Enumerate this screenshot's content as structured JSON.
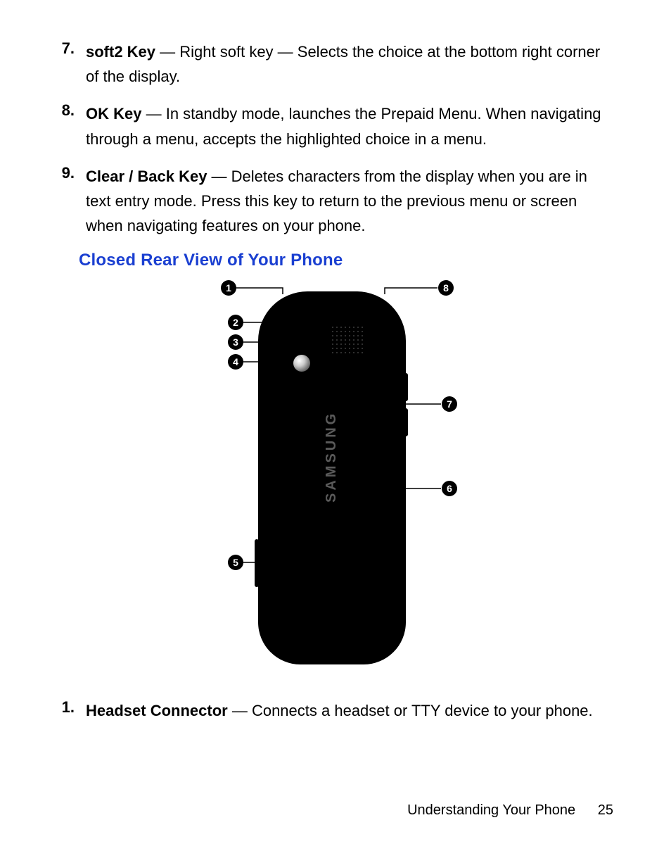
{
  "topList": [
    {
      "num": "7.",
      "term": "soft2 Key",
      "desc": " — Right soft key — Selects the choice at the bottom right corner of the display."
    },
    {
      "num": "8.",
      "term": "OK Key",
      "desc": " — In standby mode, launches the Prepaid Menu. When navigating through a menu, accepts the highlighted choice in a menu."
    },
    {
      "num": "9.",
      "term": "Clear / Back Key",
      "desc": " — Deletes characters from the display when you are in text entry mode. Press this key to return to the previous menu or screen when navigating features on your phone."
    }
  ],
  "heading": "Closed Rear View of Your Phone",
  "brand": "SAMSUNG",
  "callouts": {
    "1": "1",
    "2": "2",
    "3": "3",
    "4": "4",
    "5": "5",
    "6": "6",
    "7": "7",
    "8": "8"
  },
  "bottomList": [
    {
      "num": "1.",
      "term": "Headset Connector",
      "desc": " — Connects a headset or TTY device to your phone."
    }
  ],
  "footer": {
    "section": "Understanding Your Phone",
    "page": "25"
  }
}
